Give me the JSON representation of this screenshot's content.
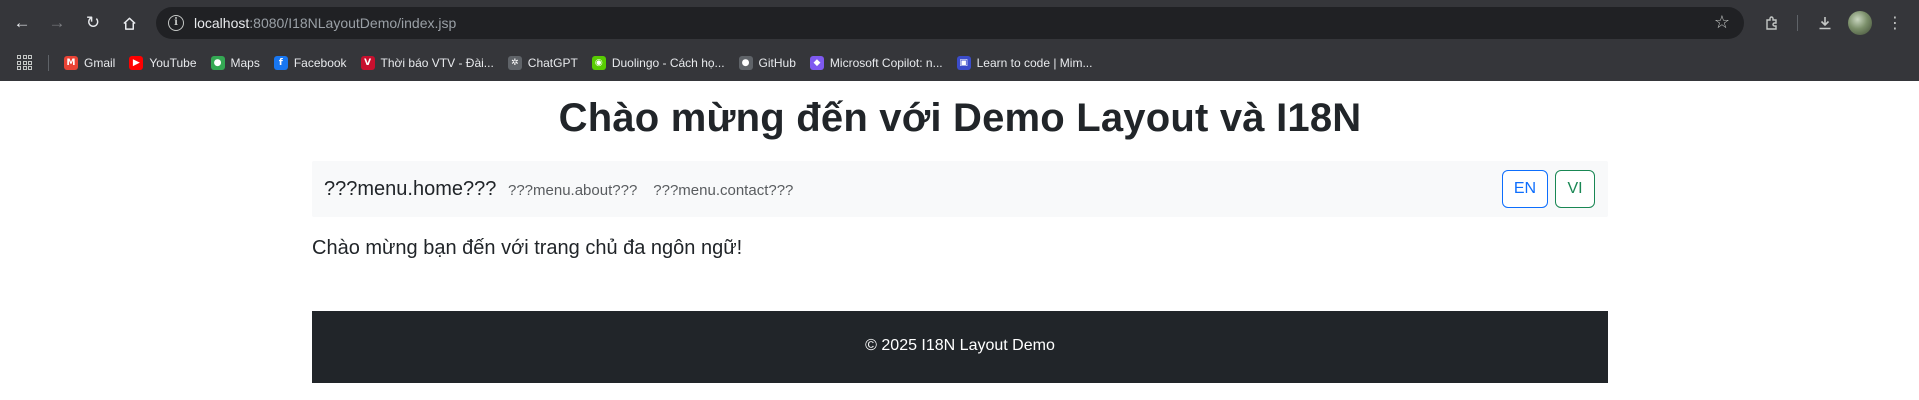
{
  "browser": {
    "url_host": "localhost",
    "url_rest": ":8080/I18NLayoutDemo/index.jsp",
    "bookmarks": [
      {
        "label": "Gmail",
        "icon": "gmail-icon",
        "color": "#ea4335",
        "glyph": "M"
      },
      {
        "label": "YouTube",
        "icon": "youtube-icon",
        "color": "#ff0000",
        "glyph": "▶"
      },
      {
        "label": "Maps",
        "icon": "maps-icon",
        "color": "#34a853",
        "glyph": "●"
      },
      {
        "label": "Facebook",
        "icon": "facebook-icon",
        "color": "#1877f2",
        "glyph": "f"
      },
      {
        "label": "Thời báo VTV - Đài...",
        "icon": "vtv-icon",
        "color": "#c8102e",
        "glyph": "V"
      },
      {
        "label": "ChatGPT",
        "icon": "chatgpt-icon",
        "color": "#5f6368",
        "glyph": "✲"
      },
      {
        "label": "Duolingo - Cách họ...",
        "icon": "duolingo-icon",
        "color": "#58cc02",
        "glyph": "◉"
      },
      {
        "label": "GitHub",
        "icon": "github-icon",
        "color": "#5f6368",
        "glyph": "●"
      },
      {
        "label": "Microsoft Copilot: n...",
        "icon": "copilot-icon",
        "color": "#7f5af0",
        "glyph": "◆"
      },
      {
        "label": "Learn to code | Mim...",
        "icon": "mimo-icon",
        "color": "#3b4cca",
        "glyph": "▣"
      }
    ]
  },
  "page": {
    "title": "Chào mừng đến với Demo Layout và I18N",
    "nav": {
      "brand": "???menu.home???",
      "links": [
        "???menu.about???",
        "???menu.contact???"
      ],
      "lang_en": "EN",
      "lang_vi": "VI"
    },
    "welcome": "Chào mừng bạn đến với trang chủ đa ngôn ngữ!",
    "footer": "© 2025 I18N Layout Demo"
  },
  "colors": {
    "primary": "#0d6efd",
    "success": "#198754",
    "footer_bg": "#212529",
    "navbar_bg": "#f8f9fa"
  }
}
